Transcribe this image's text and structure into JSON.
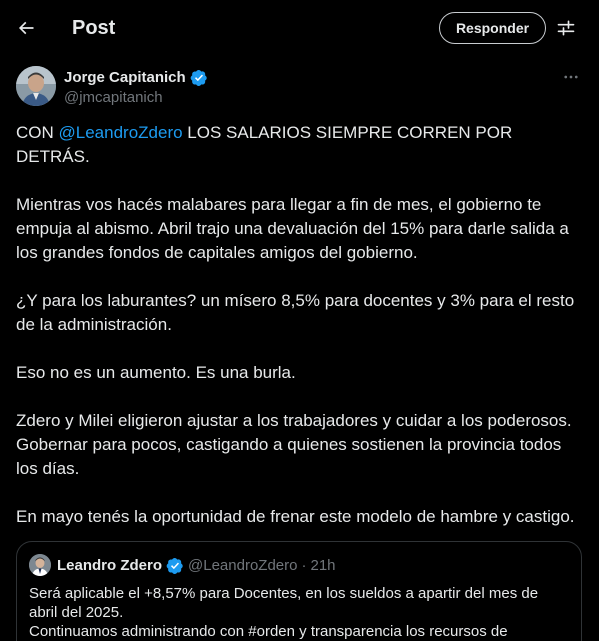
{
  "header": {
    "title": "Post",
    "reply_label": "Responder"
  },
  "author": {
    "name": "Jorge Capitanich",
    "handle": "@jmcapitanich",
    "more_icon": "more-horizontal-icon",
    "verified_color": "#1d9bf0"
  },
  "post": {
    "p1_prefix": "CON ",
    "p1_mention": "@LeandroZdero",
    "p1_suffix": " LOS SALARIOS SIEMPRE CORREN POR DETRÁS.",
    "p2": "Mientras vos hacés malabares para llegar a fin de mes, el gobierno te empuja al abismo. Abril trajo una devaluación del 15% para darle salida a los grandes fondos de capitales amigos del gobierno.",
    "p3": "¿Y para los laburantes? un mísero 8,5% para docentes y 3% para el resto de la administración.",
    "p4": "Eso no es un aumento. Es una burla.",
    "p5": "Zdero y Milei eligieron ajustar a los trabajadores y cuidar a los poderosos. Gobernar para pocos, castigando a quienes sostienen la provincia todos los días.",
    "p6": "En mayo tenés la oportunidad de frenar este modelo de hambre y castigo."
  },
  "quote": {
    "name": "Leandro Zdero",
    "handle": "@LeandroZdero",
    "separator": "·",
    "time": "21h",
    "line1": "Será aplicable el +8,57% para Docentes, en los sueldos a apartir del mes de abril del 2025.",
    "line2": "Continuamos administrando con #orden y transparencia los recursos de"
  },
  "colors": {
    "background": "#000000",
    "text": "#e7e9ea",
    "muted": "#71767b",
    "accent": "#1d9bf0",
    "border": "#2f3336"
  }
}
